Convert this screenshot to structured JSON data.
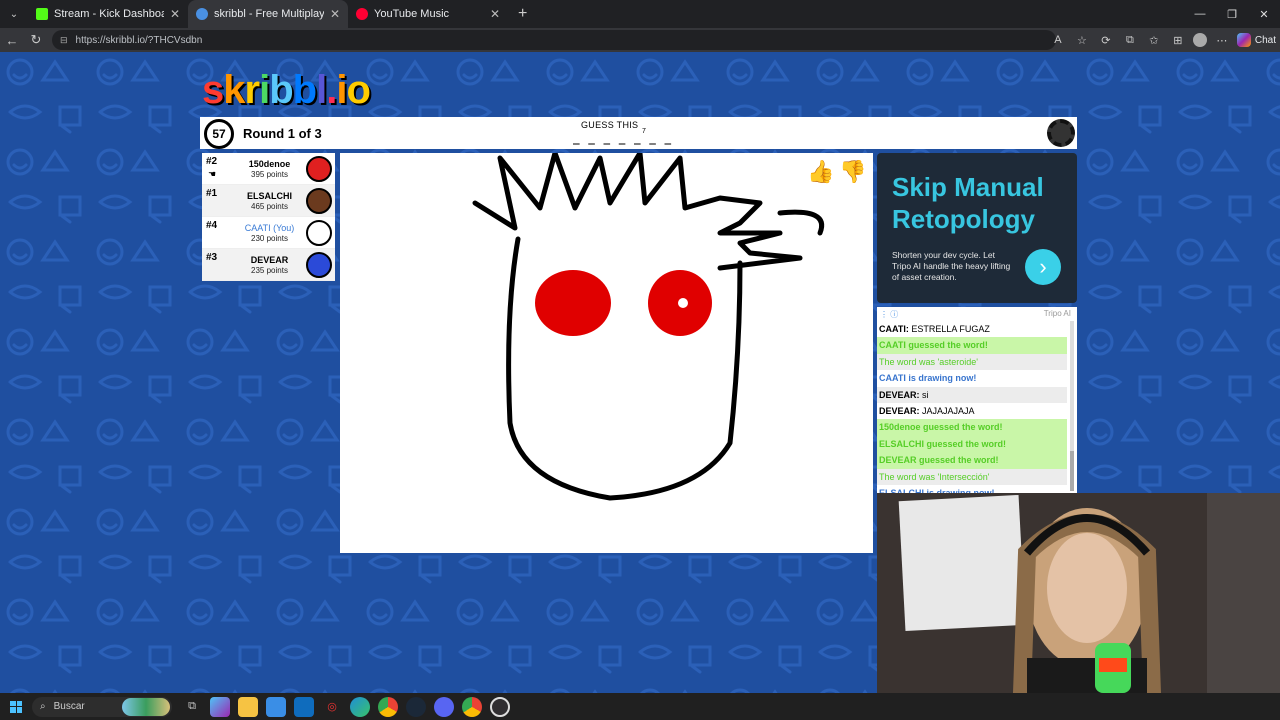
{
  "browser": {
    "tabs": [
      {
        "title": "Stream - Kick Dashboard",
        "active": false,
        "favicon_color": "#53fc18"
      },
      {
        "title": "skribbl - Free Multiplayer Drawing",
        "active": true,
        "favicon_color": "#4a90e2"
      },
      {
        "title": "YouTube Music",
        "active": false,
        "favicon_color": "#ff0033"
      }
    ],
    "url": "https://skribbl.io/?THCVsdbn",
    "chat_label": "Chat"
  },
  "game": {
    "logo_text": "skribbl.io",
    "timer": "57",
    "round_text": "Round 1 of 3",
    "guess_label": "GUESS THIS",
    "guess_blanks": "_ _ _ _ _ _ _",
    "guess_count": "7",
    "players": [
      {
        "rank": "#2",
        "name": "150denoe",
        "points": "395 points",
        "you": false,
        "avatar_color": "#e02020",
        "crown": true
      },
      {
        "rank": "#1",
        "name": "ELSALCHI",
        "points": "465 points",
        "you": false,
        "avatar_color": "#6b3a1e",
        "crown": false
      },
      {
        "rank": "#4",
        "name": "CAATI (You)",
        "points": "230 points",
        "you": true,
        "avatar_color": "#ffffff",
        "crown": false
      },
      {
        "rank": "#3",
        "name": "DEVEAR",
        "points": "235 points",
        "you": false,
        "avatar_color": "#2b4ad8",
        "crown": false
      }
    ]
  },
  "ad": {
    "title": "Skip Manual Retopology",
    "body": "Shorten your dev cycle. Let Tripo AI handle the heavy lifting of asset creation.",
    "sponsor": "Tripo AI"
  },
  "chat": {
    "messages": [
      {
        "type": "normal",
        "author": "CAATI:",
        "text": "ESTRELLA FUGAZ"
      },
      {
        "type": "green",
        "text": "CAATI guessed the word!"
      },
      {
        "type": "reveal",
        "text": "The word was 'asteroide'"
      },
      {
        "type": "blue",
        "text": "CAATI is drawing now!"
      },
      {
        "type": "normal",
        "author": "DEVEAR:",
        "text": "si"
      },
      {
        "type": "normal",
        "author": "DEVEAR:",
        "text": "JAJAJAJAJA"
      },
      {
        "type": "green",
        "text": "150denoe guessed the word!"
      },
      {
        "type": "green",
        "text": "ELSALCHI guessed the word!"
      },
      {
        "type": "green",
        "text": "DEVEAR guessed the word!"
      },
      {
        "type": "reveal",
        "text": "The word was 'Intersección'"
      },
      {
        "type": "blue",
        "text": "ELSALCHI is drawing now!"
      }
    ]
  },
  "taskbar": {
    "search_placeholder": "Buscar"
  },
  "colors": {
    "background_blue": "#1f4fa0",
    "guess_green": "#56ce27",
    "drawing_blue": "#3975ce",
    "ad_accent": "#38c6e0"
  }
}
